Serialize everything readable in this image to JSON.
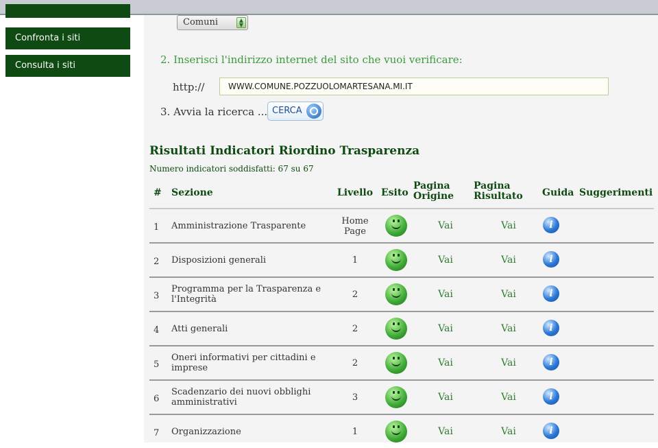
{
  "sidebar": {
    "items": [
      "Confronta i siti",
      "Consulta i siti"
    ]
  },
  "form": {
    "select_value": "Comuni",
    "step2_num": "2.",
    "step2_text": "Inserisci l'indirizzo internet del sito che vuoi verificare:",
    "http_label": "http://",
    "url_value": "WWW.COMUNE.POZZUOLOMARTESANA.MI.IT",
    "step3_num": "3.",
    "step3_text": "Avvia la ricerca ...",
    "cerca_label": "CERCA"
  },
  "results": {
    "title": "Risultati Indicatori Riordino Trasparenza",
    "count_text": "Numero indicatori soddisfatti: 67 su 67",
    "headers": {
      "num": "#",
      "sezione": "Sezione",
      "livello": "Livello",
      "esito": "Esito",
      "pagina_origine": "Pagina Origine",
      "pagina_risultato": "Pagina Risultato",
      "guida": "Guida",
      "suggerimenti": "Suggerimenti"
    },
    "rows": [
      {
        "num": "1",
        "sezione": "Amministrazione Trasparente",
        "livello": "Home Page",
        "vai1": "Vai",
        "vai2": "Vai",
        "guida": "i"
      },
      {
        "num": "2",
        "sezione": "Disposizioni generali",
        "livello": "1",
        "vai1": "Vai",
        "vai2": "Vai",
        "guida": "i"
      },
      {
        "num": "3",
        "sezione": "Programma per la Trasparenza e l'Integrità",
        "livello": "2",
        "vai1": "Vai",
        "vai2": "Vai",
        "guida": "i"
      },
      {
        "num": "4",
        "sezione": "Atti generali",
        "livello": "2",
        "vai1": "Vai",
        "vai2": "Vai",
        "guida": "i"
      },
      {
        "num": "5",
        "sezione": "Oneri informativi per cittadini e imprese",
        "livello": "2",
        "vai1": "Vai",
        "vai2": "Vai",
        "guida": "i"
      },
      {
        "num": "6",
        "sezione": "Scadenzario dei nuovi obblighi amministrativi",
        "livello": "3",
        "vai1": "Vai",
        "vai2": "Vai",
        "guida": "i"
      },
      {
        "num": "7",
        "sezione": "Organizzazione",
        "livello": "1",
        "vai1": "Vai",
        "vai2": "Vai",
        "guida": "i"
      }
    ]
  },
  "colors": {
    "sidebar_green": "#0f4a12",
    "title_green": "#0f4a12",
    "step_green": "#3c9a3c",
    "info_blue": "#2c77d6"
  }
}
